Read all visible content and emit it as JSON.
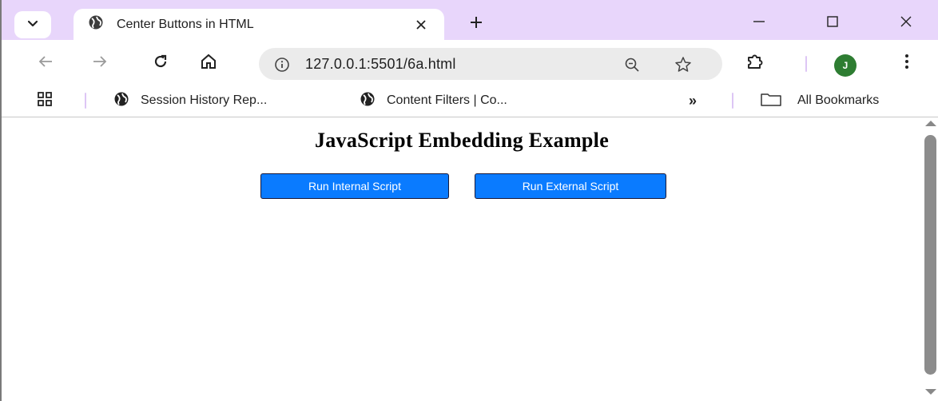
{
  "browser": {
    "tab": {
      "title": "Center Buttons in HTML"
    },
    "address": {
      "url": "127.0.0.1:5501/6a.html"
    },
    "profile_initial": "J",
    "bookmarks": [
      {
        "label": "Session History Rep..."
      },
      {
        "label": "Content Filters | Co..."
      }
    ],
    "bookmarks_overflow": "»",
    "all_bookmarks_label": "All Bookmarks",
    "accent_color": "#e8d6fb"
  },
  "page": {
    "heading": "JavaScript Embedding Example",
    "buttons": {
      "internal": "Run Internal Script",
      "external": "Run External Script"
    },
    "button_color": "#0a7bff"
  },
  "icons": [
    "tab-search-icon",
    "globe-icon",
    "close-icon",
    "plus-icon",
    "minimize-icon",
    "maximize-icon",
    "window-close-icon",
    "back-arrow-icon",
    "forward-arrow-icon",
    "reload-icon",
    "home-icon",
    "site-info-icon",
    "zoom-icon",
    "star-icon",
    "extensions-icon",
    "more-vert-icon",
    "apps-grid-icon",
    "folder-icon"
  ]
}
